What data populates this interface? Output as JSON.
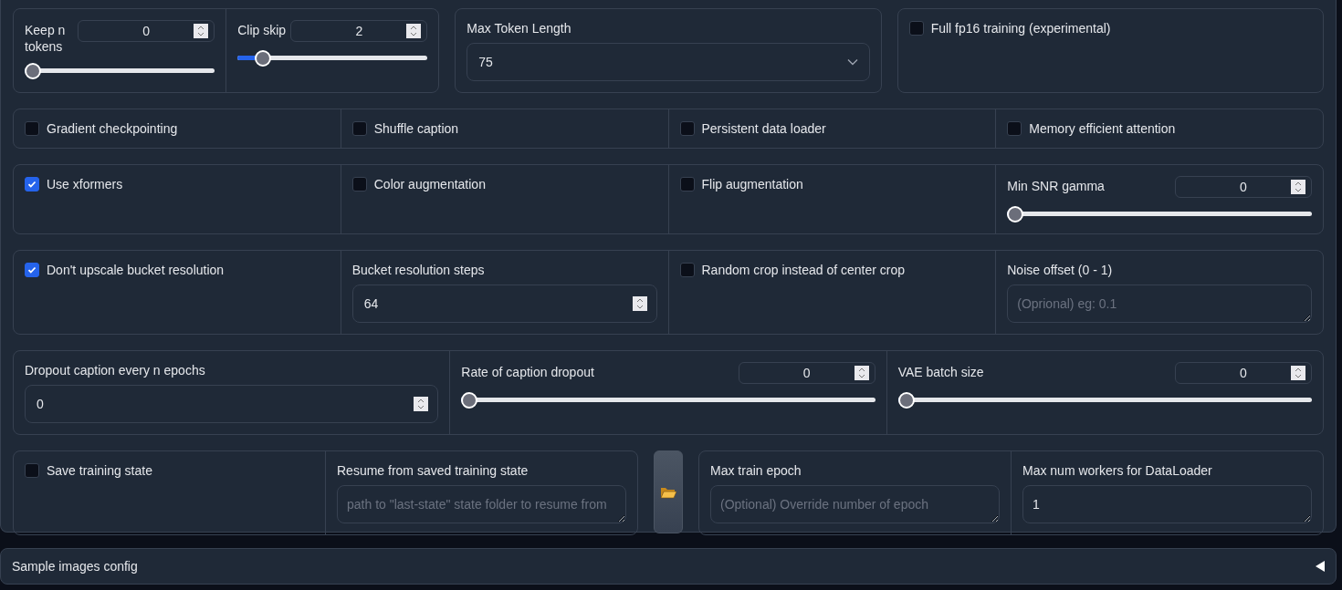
{
  "rows": [
    {
      "items": [
        {
          "kind": "group",
          "cells": [
            {
              "kind": "slider",
              "label": "Keep n tokens",
              "value": "0",
              "level": 0
            },
            {
              "kind": "slider",
              "label": "Clip skip",
              "value": "2",
              "level": 0.1
            }
          ]
        },
        {
          "kind": "group",
          "cells": [
            {
              "kind": "dropdown",
              "label": "Max Token Length",
              "value": "75"
            }
          ]
        },
        {
          "kind": "group",
          "cells": [
            {
              "kind": "checkbox",
              "label": "Full fp16 training (experimental)",
              "checked": false
            }
          ]
        }
      ]
    },
    {
      "items": [
        {
          "kind": "group",
          "cells": [
            {
              "kind": "checkbox",
              "label": "Gradient checkpointing",
              "checked": false
            },
            {
              "kind": "checkbox",
              "label": "Shuffle caption",
              "checked": false
            },
            {
              "kind": "checkbox",
              "label": "Persistent data loader",
              "checked": false
            },
            {
              "kind": "checkbox",
              "label": "Memory efficient attention",
              "checked": false
            }
          ]
        }
      ]
    },
    {
      "items": [
        {
          "kind": "group",
          "cells": [
            {
              "kind": "checkbox",
              "label": "Use xformers",
              "checked": true
            },
            {
              "kind": "checkbox",
              "label": "Color augmentation",
              "checked": false
            },
            {
              "kind": "checkbox",
              "label": "Flip augmentation",
              "checked": false
            },
            {
              "kind": "slider",
              "label": "Min SNR gamma",
              "value": "0",
              "level": 0
            }
          ]
        }
      ]
    },
    {
      "items": [
        {
          "kind": "group",
          "cells": [
            {
              "kind": "checkbox",
              "label": "Don't upscale bucket resolution",
              "checked": true
            },
            {
              "kind": "number",
              "label": "Bucket resolution steps",
              "value": "64"
            },
            {
              "kind": "checkbox",
              "label": "Random crop instead of center crop",
              "checked": false
            },
            {
              "kind": "textbox",
              "label": "Noise offset (0 - 1)",
              "placeholder": "(Oprional) eg: 0.1"
            }
          ]
        }
      ]
    },
    {
      "items": [
        {
          "kind": "group",
          "cells": [
            {
              "kind": "number",
              "label": "Dropout caption every n epochs",
              "value": "0"
            },
            {
              "kind": "slider",
              "label": "Rate of caption dropout",
              "value": "0",
              "level": 0
            },
            {
              "kind": "slider",
              "label": "VAE batch size",
              "value": "0",
              "level": 0
            }
          ]
        }
      ]
    },
    {
      "items": [
        {
          "kind": "group",
          "cells": [
            {
              "kind": "checkbox",
              "label": "Save training state",
              "checked": false
            },
            {
              "kind": "textbox",
              "label": "Resume from saved training state",
              "placeholder": "path to \"last-state\" state folder to resume from"
            }
          ]
        },
        {
          "kind": "folder_button"
        },
        {
          "kind": "group",
          "cells": [
            {
              "kind": "textbox",
              "label": "Max train epoch",
              "placeholder": "(Optional) Override number of epoch"
            },
            {
              "kind": "textbox",
              "label": "Max num workers for DataLoader",
              "value": "1"
            }
          ]
        }
      ]
    }
  ],
  "accordion": {
    "label": "Sample images config",
    "expanded": false
  }
}
